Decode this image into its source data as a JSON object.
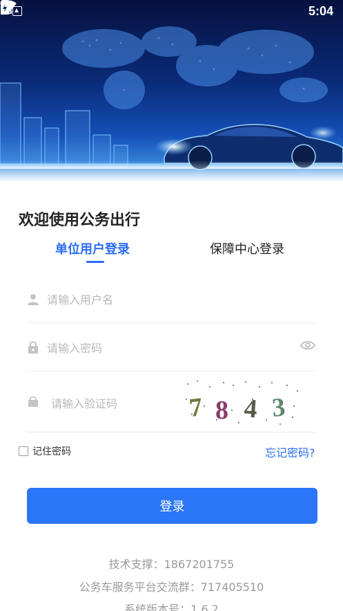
{
  "status_bar": {
    "time": "5:04",
    "icons": [
      "notification-icon",
      "wifi-icon",
      "no-sim-icon",
      "battery-icon"
    ]
  },
  "banner": {
    "description_icon": "car-world-map-banner"
  },
  "login": {
    "welcome": "欢迎使用公务出行",
    "tabs": [
      {
        "label": "单位用户登录",
        "active": true
      },
      {
        "label": "保障中心登录",
        "active": false
      }
    ],
    "username_placeholder": "请输入用户名",
    "password_placeholder": "请输入密码",
    "captcha_placeholder": "请输入验证码",
    "captcha_code": [
      "7",
      "8",
      "4",
      "3"
    ],
    "remember_label": "记住密码",
    "remember_checked": false,
    "forgot_label": "忘记密码?",
    "submit_label": "登录"
  },
  "footer": {
    "support": "技术支撑：1867201755",
    "group": "公务车服务平台交流群：717405510",
    "version": "系统版本号：1.6.2"
  },
  "colors": {
    "accent": "#2b6cf5",
    "button": "#2b76f6",
    "text_muted": "#9a9a9a"
  }
}
